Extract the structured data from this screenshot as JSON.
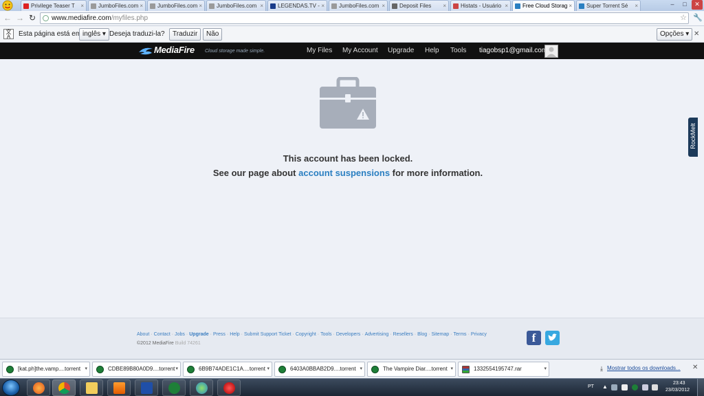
{
  "browser": {
    "tabs": [
      {
        "title": "Privilege Teaser T",
        "favicon_color": "#d22",
        "active": false
      },
      {
        "title": "JumboFiles.com",
        "favicon_color": "#9a9a9a",
        "active": false
      },
      {
        "title": "JumboFiles.com",
        "favicon_color": "#9a9a9a",
        "active": false
      },
      {
        "title": "JumboFiles.com",
        "favicon_color": "#9a9a9a",
        "active": false
      },
      {
        "title": "LEGENDAS.TV -",
        "favicon_color": "#1a3c8a",
        "active": false
      },
      {
        "title": "JumboFiles.com",
        "favicon_color": "#9a9a9a",
        "active": false
      },
      {
        "title": "Deposit Files",
        "favicon_color": "#666",
        "active": false
      },
      {
        "title": "Histats - Usuário",
        "favicon_color": "#c44",
        "active": false
      },
      {
        "title": "Free Cloud Storag",
        "favicon_color": "#2a7fc1",
        "active": true
      },
      {
        "title": "Super Torrent Sé",
        "favicon_color": "#2a7fc1",
        "active": false
      }
    ],
    "url_host": "www.mediafire.com",
    "url_path": "/myfiles.php",
    "window_buttons": [
      "–",
      "□",
      "✕"
    ]
  },
  "translate_bar": {
    "prefix": "Esta página está em",
    "language": "inglês",
    "question": "Deseja traduzi-la?",
    "translate_label": "Traduzir",
    "no_label": "Não",
    "options_label": "Opções"
  },
  "site_header": {
    "brand": "MediaFire",
    "tagline": "Cloud storage made simple.",
    "nav": [
      "My Files",
      "My Account",
      "Upgrade",
      "Help",
      "Tools"
    ],
    "user_email": "tiagobsp1@gmail.com"
  },
  "main": {
    "locked_message": "This account has been locked.",
    "info_prefix": "See our page about ",
    "info_link": "account suspensions",
    "info_suffix": " for more information.",
    "side_tab": "RockMelt"
  },
  "footer": {
    "links": [
      "About",
      "Contact",
      "Jobs",
      "Upgrade",
      "Press",
      "Help",
      "Submit Support Ticket",
      "Copyright",
      "Tools",
      "Developers",
      "Advertising",
      "Resellers",
      "Blog",
      "Sitemap",
      "Terms",
      "Privacy"
    ],
    "copyright": "©2012 MediaFire",
    "build": "Build 74261"
  },
  "downloads": {
    "items": [
      {
        "name": "[kat.ph]the.vamp....torrent",
        "type": "torrent"
      },
      {
        "name": "CDBE89B80A0D9....torrent",
        "type": "torrent"
      },
      {
        "name": "6B9B74ADE1C1A....torrent",
        "type": "torrent"
      },
      {
        "name": "6403A0BBAB2D9....torrent",
        "type": "torrent"
      },
      {
        "name": "The Vampire Diar....torrent",
        "type": "torrent"
      },
      {
        "name": "1332554195747.rar",
        "type": "rar"
      }
    ],
    "show_all_label": "Mostrar todos os downloads..."
  },
  "taskbar": {
    "language": "PT",
    "time": "23:43",
    "date": "23/03/2012"
  }
}
